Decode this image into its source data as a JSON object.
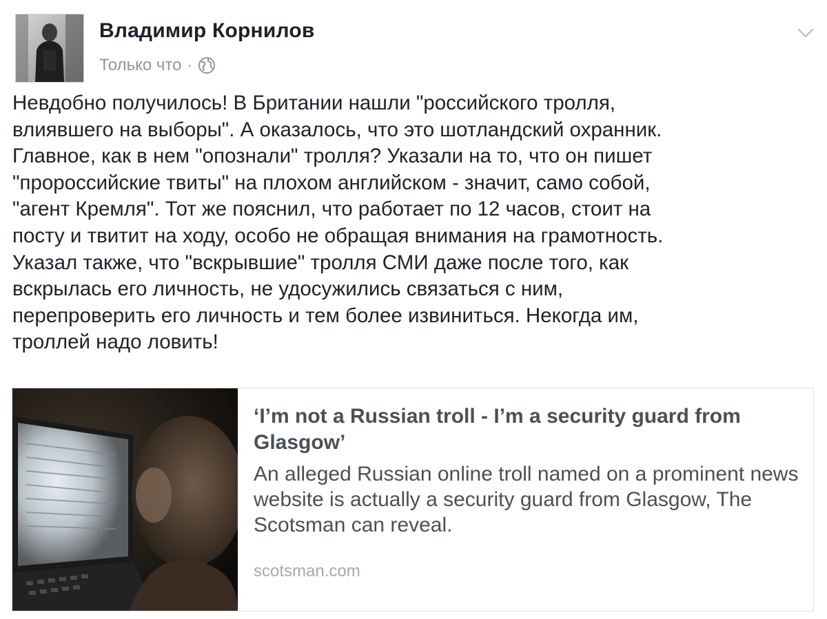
{
  "post": {
    "author": "Владимир Корнилов",
    "timestamp": "Только что",
    "separator": "·",
    "privacy_icon": "globe-icon",
    "menu_icon": "chevron-down-icon",
    "text": "Невдобно получилось! В Британии нашли \"российского тролля,\nвлиявшего на выборы\". А оказалось, что это шотландский охранник.\nГлавное, как в нем \"опознали\" тролля? Указали на то, что он пишет\n\"пророссийские твиты\" на плохом английском - значит, само собой,\n\"агент Кремля\". Тот же пояснил, что работает по 12 часов, стоит на\nпосту и твитит на ходу, особо не обращая внимания на грамотность.\nУказал также, что \"вскрывшие\" тролля СМИ даже после того, как\nвскрылась его личность, не удосужились связаться с ним,\nперепроверить его личность и тем более извиниться. Некогда им,\nтроллей надо ловить!"
  },
  "link_card": {
    "title": "‘I’m not a Russian troll - I’m a security guard from Glasgow’",
    "description": "An alleged Russian online troll named on a prominent news website is actually a security guard from Glasgow, The Scotsman can reveal.",
    "domain": "scotsman.com"
  },
  "colors": {
    "text_primary": "#1d2129",
    "text_secondary": "#90949c",
    "card_text": "#4b4f56",
    "card_domain": "#a5a8ad",
    "border": "#dddfe2"
  }
}
